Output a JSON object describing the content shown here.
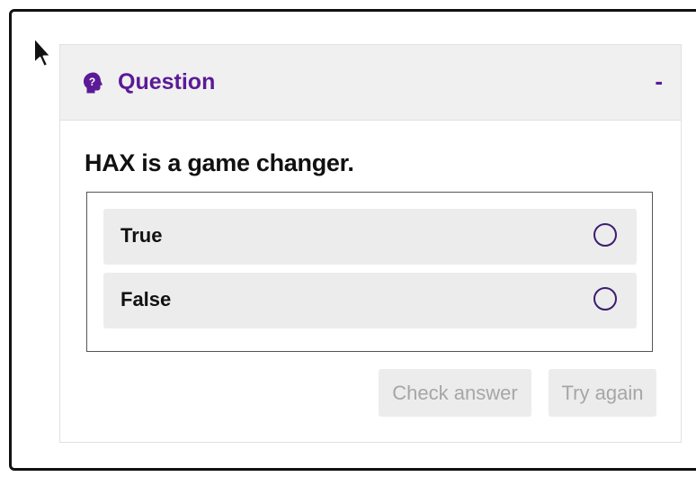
{
  "card": {
    "icon": "question-head-icon",
    "title": "Question",
    "collapse_label": "-"
  },
  "question": {
    "text": "HAX is a game changer."
  },
  "answers": [
    {
      "label": "True",
      "selected": false
    },
    {
      "label": "False",
      "selected": false
    }
  ],
  "actions": {
    "check_label": "Check answer",
    "retry_label": "Try again",
    "disabled": true
  },
  "colors": {
    "accent": "#5b1a96",
    "radio_border": "#3b1d6e",
    "header_bg": "#f0f0f0",
    "answer_bg": "#ececec",
    "disabled_text": "#a6a6a6"
  }
}
